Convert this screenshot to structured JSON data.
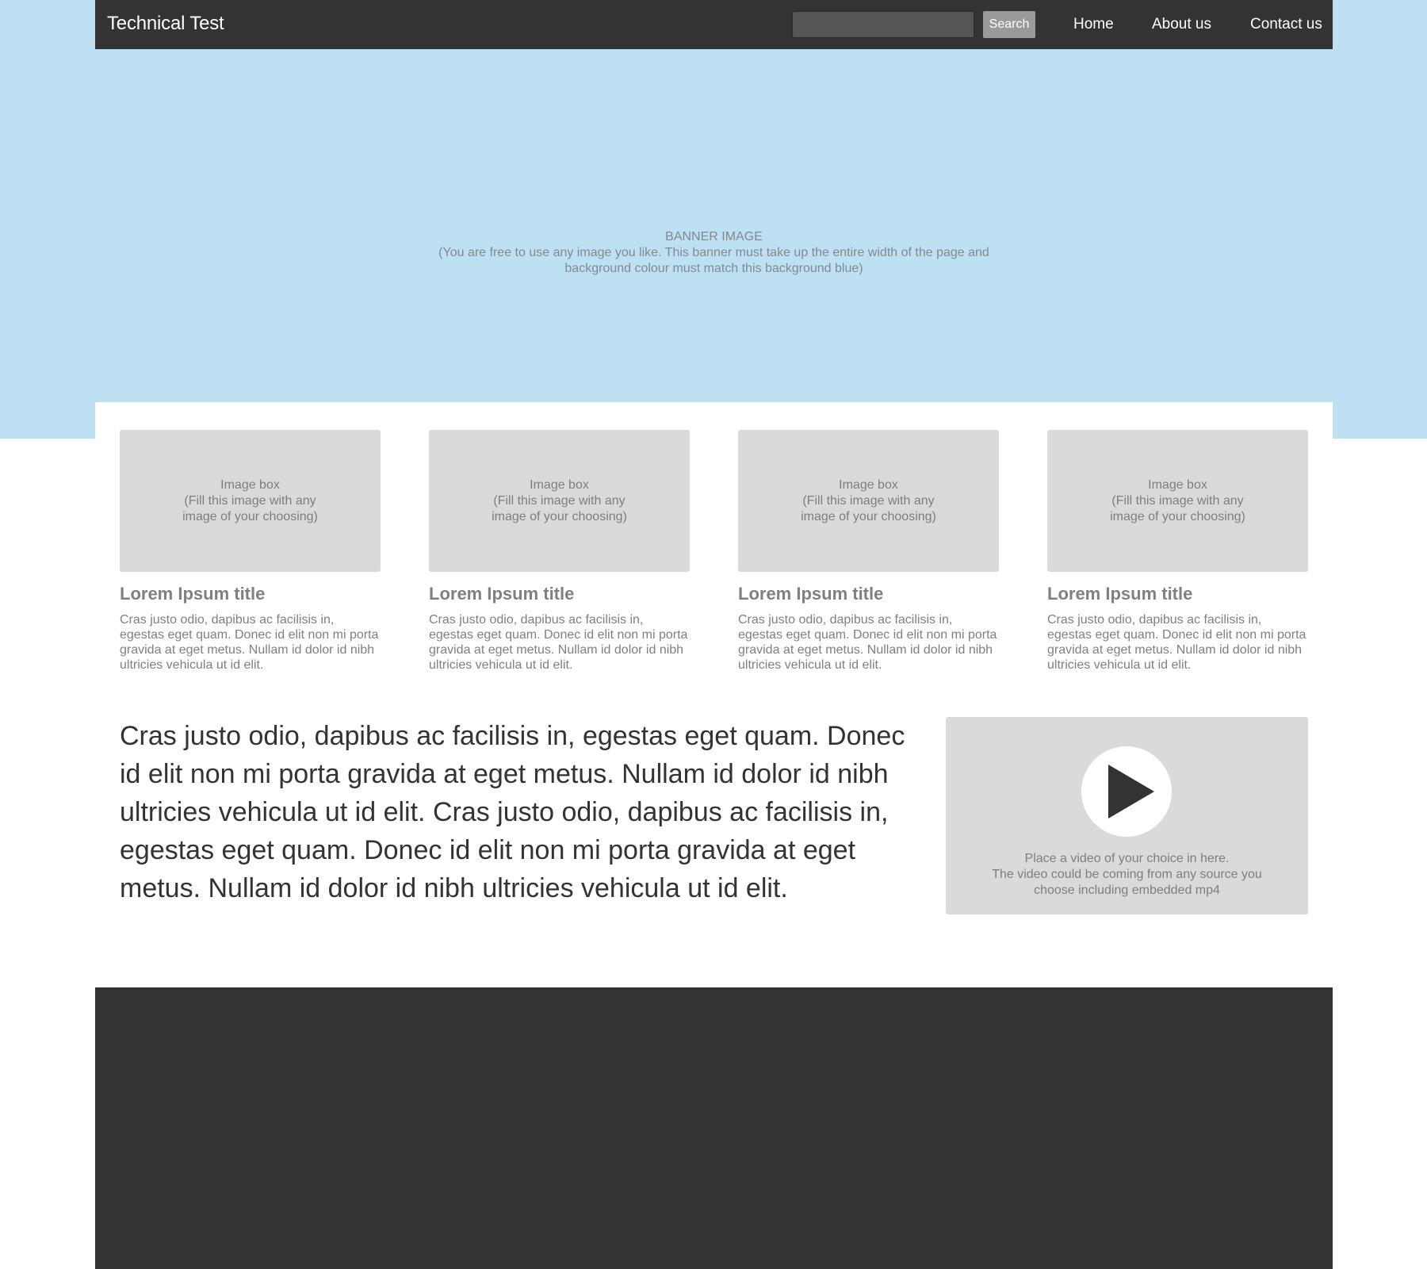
{
  "header": {
    "site_title": "Technical Test",
    "search_value": "",
    "search_placeholder": "",
    "search_button": "Search",
    "nav": [
      {
        "label": "Home"
      },
      {
        "label": "About us"
      },
      {
        "label": "Contact us"
      }
    ]
  },
  "banner": {
    "heading": "BANNER IMAGE",
    "description": "(You are free to use any image you like. This banner must take up the entire width of the page and background colour must match this background blue)"
  },
  "cards": [
    {
      "image_label": "Image box",
      "image_note": "(Fill this image with any image of your choosing)",
      "title": "Lorem Ipsum title",
      "body": "Cras justo odio, dapibus ac facilisis in, egestas eget quam. Donec id elit non mi porta gravida at eget metus. Nullam id dolor id nibh ultricies vehicula ut id elit."
    },
    {
      "image_label": "Image box",
      "image_note": "(Fill this image with any image of your choosing)",
      "title": "Lorem Ipsum title",
      "body": "Cras justo odio, dapibus ac facilisis in, egestas eget quam. Donec id elit non mi porta gravida at eget metus. Nullam id dolor id nibh ultricies vehicula ut id elit."
    },
    {
      "image_label": "Image box",
      "image_note": "(Fill this image with any image of your choosing)",
      "title": "Lorem Ipsum title",
      "body": "Cras justo odio, dapibus ac facilisis in, egestas eget quam. Donec id elit non mi porta gravida at eget metus. Nullam id dolor id nibh ultricies vehicula ut id elit."
    },
    {
      "image_label": "Image box",
      "image_note": "(Fill this image with any image of your choosing)",
      "title": "Lorem Ipsum title",
      "body": "Cras justo odio, dapibus ac facilisis in, egestas eget quam. Donec id elit non mi porta gravida at eget metus. Nullam id dolor id nibh ultricies vehicula ut id elit."
    }
  ],
  "intro": {
    "text": "Cras justo odio, dapibus ac facilisis in, egestas eget quam. Donec id elit non mi porta gravida at eget metus. Nullam id dolor id nibh ultricies vehicula ut id elit. Cras justo odio, dapibus ac facilisis in, egestas eget quam. Donec id elit non mi porta gravida at eget metus. Nullam id dolor id nibh ultricies vehicula ut id elit."
  },
  "video": {
    "icon": "play-icon",
    "caption_line1": "Place a video of your choice in here.",
    "caption_line2": "The video could be coming from any source you choose including embedded mp4"
  },
  "colors": {
    "header_bg": "#333333",
    "banner_bg": "#bde0f3",
    "placeholder_bg": "#dadada",
    "footer_bg": "#333333",
    "search_button_bg": "#9a9a9a"
  }
}
